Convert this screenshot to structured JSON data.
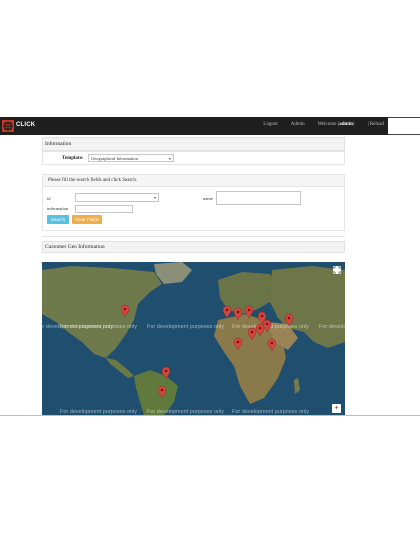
{
  "app": {
    "brand": "CLICK"
  },
  "nav": {
    "logout": "Logout",
    "admin": "Admin",
    "welcome_prefix": "Welcome (",
    "welcome_user": "admin",
    "welcome_suffix": ")",
    "reload": "| Reload"
  },
  "information": {
    "header": "Information",
    "template_label": "Template:",
    "template_value": "Geographical Information"
  },
  "search": {
    "instruction": "Please fill the search fields and click Search.",
    "field_id_label": "id",
    "field_name_label": "name",
    "field_information_label": "information",
    "search_button": "Search",
    "clear_button": "Clear Fields"
  },
  "geo": {
    "header": "Customer Geo Information",
    "watermark": "For development purposes only",
    "zoom_in": "+"
  },
  "colors": {
    "navbar": "#1f1f1f",
    "search_button": "#5bc0de",
    "clear_button": "#f0ad4e",
    "marker": "#d6453d",
    "water": "#1f4e6e",
    "land": "#6f7a4c"
  },
  "icons": [
    "logo-icon",
    "caret-down-icon",
    "fullscreen-icon",
    "map-marker-icon"
  ]
}
